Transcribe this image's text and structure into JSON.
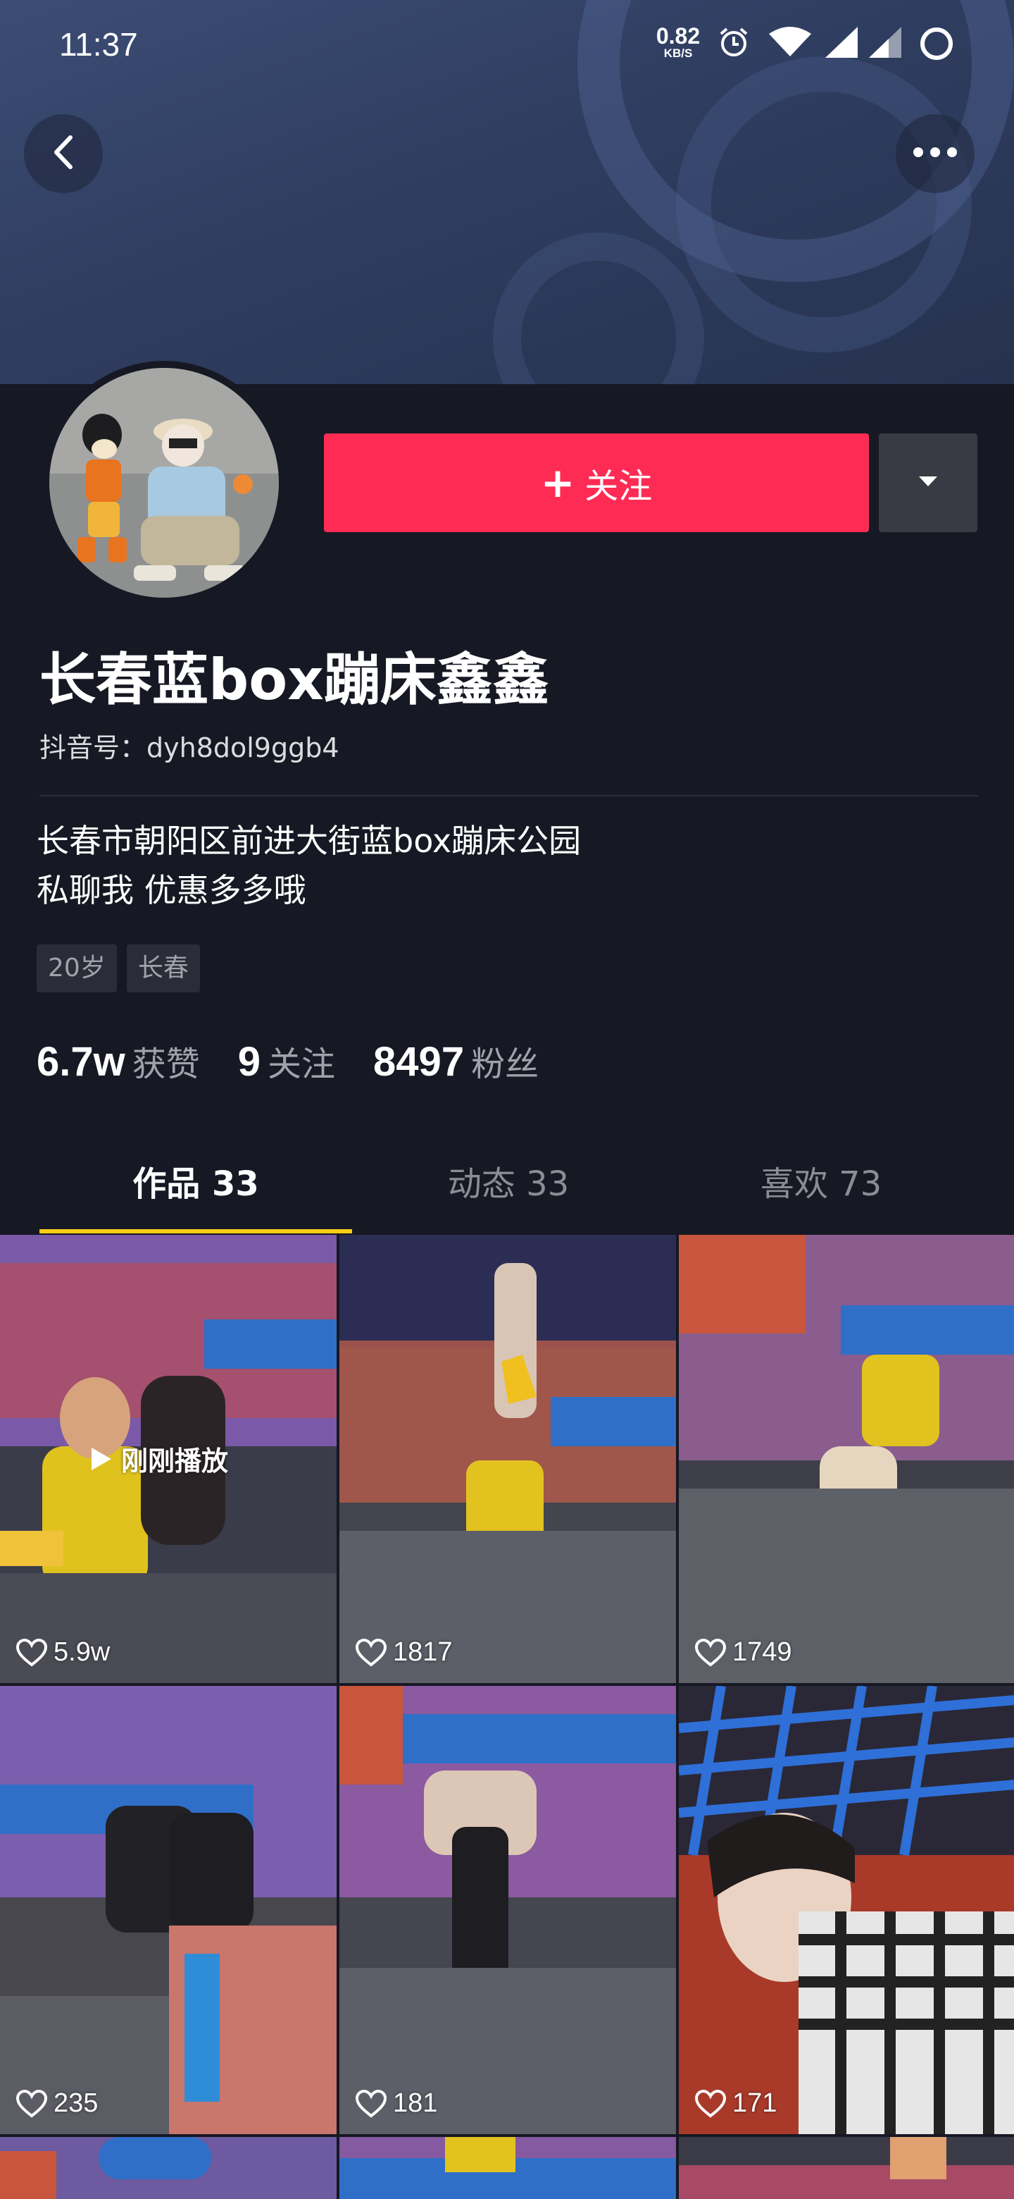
{
  "status_bar": {
    "time": "11:37",
    "net_speed_value": "0.82",
    "net_speed_unit": "KB/S",
    "icons": [
      "alarm-icon",
      "wifi-icon",
      "signal-icon",
      "signal-icon-2",
      "battery-ring-icon"
    ]
  },
  "header": {
    "back_icon": "chevron-left-icon",
    "more_icon": "more-dots-icon"
  },
  "profile": {
    "follow_label": "关注",
    "follow_icon": "plus-icon",
    "dropdown_icon": "caret-down-icon",
    "nickname": "长春蓝box蹦床鑫鑫",
    "douyin_id": "抖音号：dyh8dol9ggb4",
    "bio_line1": "长春市朝阳区前进大街蓝box蹦床公园",
    "bio_line2": "私聊我 优惠多多哦",
    "tags": [
      "20岁",
      "长春"
    ],
    "stats": {
      "likes_num": "6.7w",
      "likes_label": "获赞",
      "following_num": "9",
      "following_label": "关注",
      "followers_num": "8497",
      "followers_label": "粉丝"
    }
  },
  "tabs": [
    {
      "label": "作品 33",
      "active": true
    },
    {
      "label": "动态 33",
      "active": false
    },
    {
      "label": "喜欢 73",
      "active": false
    }
  ],
  "videos": [
    {
      "likes": "5.9w",
      "overlay": "刚刚播放"
    },
    {
      "likes": "1817"
    },
    {
      "likes": "1749"
    },
    {
      "likes": "235"
    },
    {
      "likes": "181"
    },
    {
      "likes": "171"
    }
  ],
  "colors": {
    "background": "#161823",
    "follow_button": "#fe2c55",
    "tab_indicator": "#face15",
    "secondary_text": "#a0a2ab"
  }
}
